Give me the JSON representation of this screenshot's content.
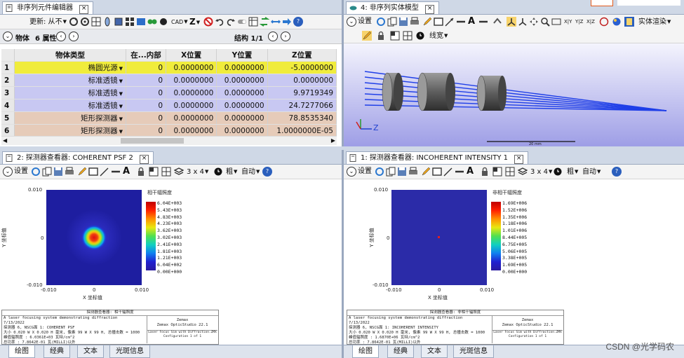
{
  "editor": {
    "title": "非序列元件编辑器",
    "update_label": "更新: 从不",
    "cad_label": "CAD",
    "z_label": "Z",
    "objects_label": "物体",
    "properties_label": "6 属性",
    "structure_label": "结构 1/1",
    "headers": [
      "物体类型",
      "在...内部",
      "X位置",
      "Y位置",
      "Z位置"
    ],
    "rows": [
      {
        "n": "1",
        "type": "椭圆光源",
        "inside": "0",
        "x": "0.0000000",
        "y": "0.0000000",
        "z": "-5.0000000"
      },
      {
        "n": "2",
        "type": "标准透镜",
        "inside": "0",
        "x": "0.0000000",
        "y": "0.0000000",
        "z": "0.0000000"
      },
      {
        "n": "3",
        "type": "标准透镜",
        "inside": "0",
        "x": "0.0000000",
        "y": "0.0000000",
        "z": "9.9719349"
      },
      {
        "n": "4",
        "type": "标准透镜",
        "inside": "0",
        "x": "0.0000000",
        "y": "0.0000000",
        "z": "24.7277066"
      },
      {
        "n": "5",
        "type": "矩形探测器",
        "inside": "0",
        "x": "0.0000000",
        "y": "0.0000000",
        "z": "78.8535340"
      },
      {
        "n": "6",
        "type": "矩形探测器",
        "inside": "0",
        "x": "0.0000000",
        "y": "0.0000000",
        "z": "1.0000000E-05"
      }
    ]
  },
  "model": {
    "title": "4: 非序列实体模型",
    "settings_label": "设置",
    "render_label": "实体渲染",
    "line_label": "线宽",
    "axis_z": "Z",
    "scale_label": "20 mm"
  },
  "viewer_left": {
    "title": "2: 探测器查看器: COHERENT PSF 2",
    "settings_label": "设置",
    "grid_label": "3 x 4",
    "thick_label": "粗",
    "auto_label": "自动",
    "plot_title": "相干辐照度",
    "y_axis": "Y 坐标值",
    "x_axis": "X 坐标值",
    "ticks": {
      "top": "0.010",
      "mid": "0",
      "bot": "-0.010",
      "xl": "-0.010",
      "xm": "0",
      "xr": "0.010"
    },
    "colorbar": [
      "6.04E+003",
      "5.43E+003",
      "4.83E+003",
      "4.23E+003",
      "3.62E+003",
      "3.02E+003",
      "2.41E+003",
      "1.81E+003",
      "1.21E+003",
      "6.04E+002",
      "0.00E+000"
    ],
    "info_header": "探测器查看器: 相干辐照度",
    "info_lines": [
      "A laser focusing system demonstrating diffraction",
      "7/13/2022",
      "探测器 6, NSCG面 1: COHERENT PSF",
      "大小 0.020 W X 0.020 H 毫米, 像素 99 W X 99 H, 总撞击数 = 1000",
      "峰值辐照度 : 6.0361E+03 瓦特/cm^2",
      "总功率 : 7.8642E-01 瓦(MILLI)以外"
    ],
    "info_company": "Zemax",
    "info_product": "Zemax OpticStudio 22.1",
    "info_file": "Laser Focus Sim with Diffraction.ZMX Configuration 1 of 1"
  },
  "viewer_right": {
    "title": "1: 探测器查看器: INCOHERENT INTENSITY 1",
    "settings_label": "设置",
    "grid_label": "3 x 4",
    "thick_label": "粗",
    "auto_label": "自动",
    "plot_title": "非相干辐照度",
    "y_axis": "Y 坐标值",
    "x_axis": "X 坐标值",
    "ticks": {
      "top": "0.010",
      "mid": "0",
      "bot": "-0.010",
      "xl": "-0.010",
      "xm": "0",
      "xr": "0.010"
    },
    "colorbar": [
      "1.69E+006",
      "1.52E+006",
      "1.35E+006",
      "1.18E+006",
      "1.01E+006",
      "8.44E+005",
      "6.75E+005",
      "5.06E+005",
      "3.38E+005",
      "1.69E+005",
      "0.00E+000"
    ],
    "info_header": "探测器查看器: 非相干辐照度",
    "info_lines": [
      "A laser focusing system demonstrating diffraction",
      "7/13/2022",
      "探测器 6, NSCG面 1: INCOHERENT INTENSITY",
      "大小 0.020 W X 0.020 H 毫米, 像素 99 W X 99 H, 总撞击数 = 1000",
      "峰值辐照度 : 1.6870E+06 瓦特/cm^2",
      "总功率 : 7.8642E-01 瓦(MILLI)以外"
    ],
    "info_company": "Zemax",
    "info_product": "Zemax OpticStudio 22.1",
    "info_file": "Laser Focus Sim with Diffraction.ZMX Configuration 1 of 1"
  },
  "bottom_tabs": [
    "绘图",
    "经典",
    "文本",
    "光斑信息"
  ],
  "watermark": "CSDN @光学码农",
  "colors": {
    "source_row": "#f0ec3c",
    "lens_row": "#c8c8f2",
    "detector_row": "#e6cbb9",
    "plot_bg": "#1e1ea0"
  }
}
